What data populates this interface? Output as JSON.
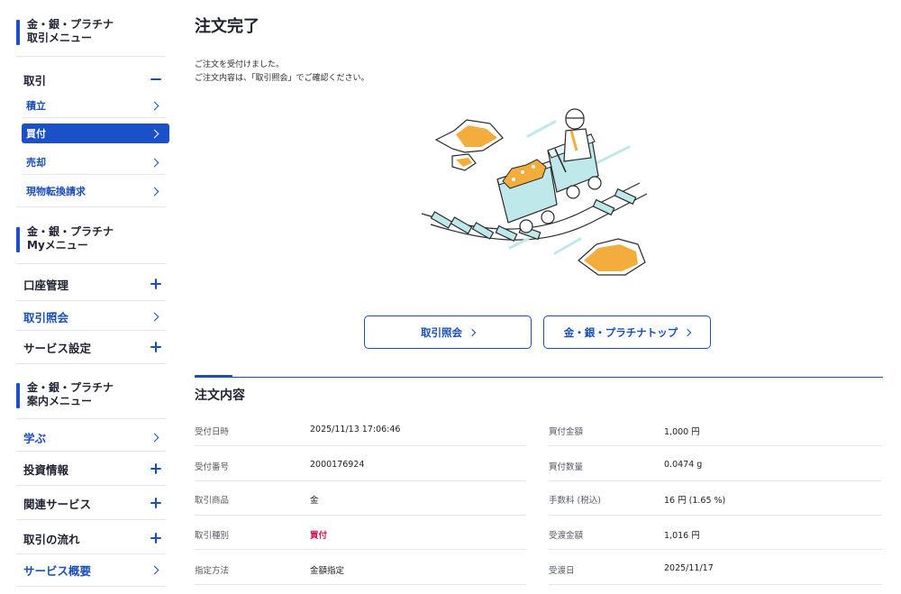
{
  "sidebar": {
    "menu1": {
      "line1": "金・銀・プラチナ",
      "line2": "取引メニュー",
      "section": "取引",
      "items": [
        "積立",
        "買付",
        "売却",
        "現物転換請求"
      ]
    },
    "menu2": {
      "line1": "金・銀・プラチナ",
      "line2": "Myメニュー",
      "items": [
        "口座管理",
        "取引照会",
        "サービス設定"
      ]
    },
    "menu3": {
      "line1": "金・銀・プラチナ",
      "line2": "案内メニュー",
      "items": [
        "学ぶ",
        "投資情報",
        "関連サービス",
        "取引の流れ",
        "サービス概要"
      ]
    }
  },
  "main": {
    "title": "注文完了",
    "message_line1": "ご注文を受付けました。",
    "message_line2": "ご注文内容は、「取引照会」でご確認ください。",
    "buttons": [
      "取引照会",
      "金・銀・プラチナトップ"
    ],
    "section_title": "注文内容",
    "details_left": [
      {
        "label": "受付日時",
        "value": "2025/11/13 17:06:46"
      },
      {
        "label": "受付番号",
        "value": "2000176924"
      },
      {
        "label": "取引商品",
        "value": "金"
      },
      {
        "label": "取引種別",
        "value": "買付"
      },
      {
        "label": "指定方法",
        "value": "金額指定"
      }
    ],
    "details_right": [
      {
        "label": "買付金額",
        "value": "1,000 円"
      },
      {
        "label": "買付数量",
        "value": "0.0474 g"
      },
      {
        "label": "手数料 (税込)",
        "value": "16 円 (1.65 %)"
      },
      {
        "label": "受渡金額",
        "value": "1,016 円"
      },
      {
        "label": "受渡日",
        "value": "2025/11/17"
      }
    ]
  },
  "colors": {
    "accent": "#1a50c8",
    "link": "#1a4fb8",
    "highlight_red": "#d0144a",
    "gold": "#f2ad3c",
    "cart": "#bfe8ea"
  },
  "icons": [
    "minus-icon",
    "chevron-right-icon",
    "plus-icon"
  ]
}
